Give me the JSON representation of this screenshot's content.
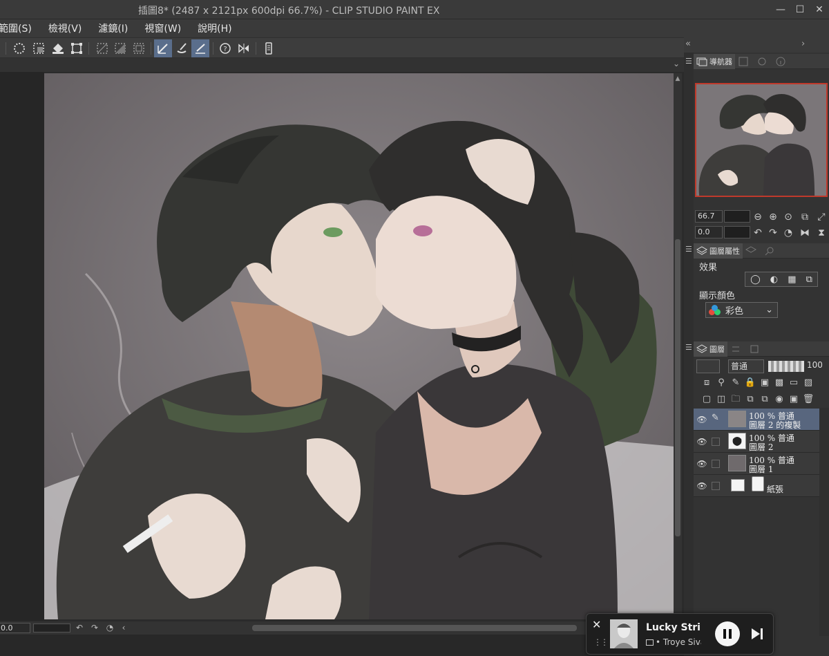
{
  "window": {
    "title": "插圖8* (2487 x 2121px 600dpi 66.7%)  - CLIP STUDIO PAINT EX",
    "minimize": "—",
    "maximize": "☐",
    "close": "✕"
  },
  "menu": [
    {
      "label": "範圍(S)"
    },
    {
      "label": "檢視(V)"
    },
    {
      "label": "濾鏡(I)"
    },
    {
      "label": "視窗(W)"
    },
    {
      "label": "說明(H)"
    }
  ],
  "toolbar": {
    "collapse_left": "«",
    "collapse_right": "›"
  },
  "navigator": {
    "tab_label": "導航器",
    "zoom": "66.7",
    "rotation": "0.0"
  },
  "layer_property": {
    "tab_label": "圖層屬性",
    "effect_label": "效果",
    "display_color_label": "顯示顏色",
    "display_color_value": "彩色"
  },
  "layers_panel": {
    "tab_label": "圖層",
    "blend_mode": "普通",
    "opacity": "100",
    "layers": [
      {
        "line1": "100 % 普通",
        "line2": "圖層 2 的複製",
        "selected": true
      },
      {
        "line1": "100 % 普通",
        "line2": "圖層 2",
        "selected": false
      },
      {
        "line1": "100 % 普通",
        "line2": "圖層 1",
        "selected": false
      },
      {
        "line1": "",
        "line2": "紙張",
        "selected": false
      }
    ]
  },
  "statusbar": {
    "zoom": "0.0"
  },
  "media": {
    "song": "Lucky Strike",
    "artist": "• Troye Sivan"
  },
  "colors": {
    "accent_active": "#5a6e8c",
    "selected_layer": "#58667e",
    "nav_frame": "#c0392b"
  }
}
